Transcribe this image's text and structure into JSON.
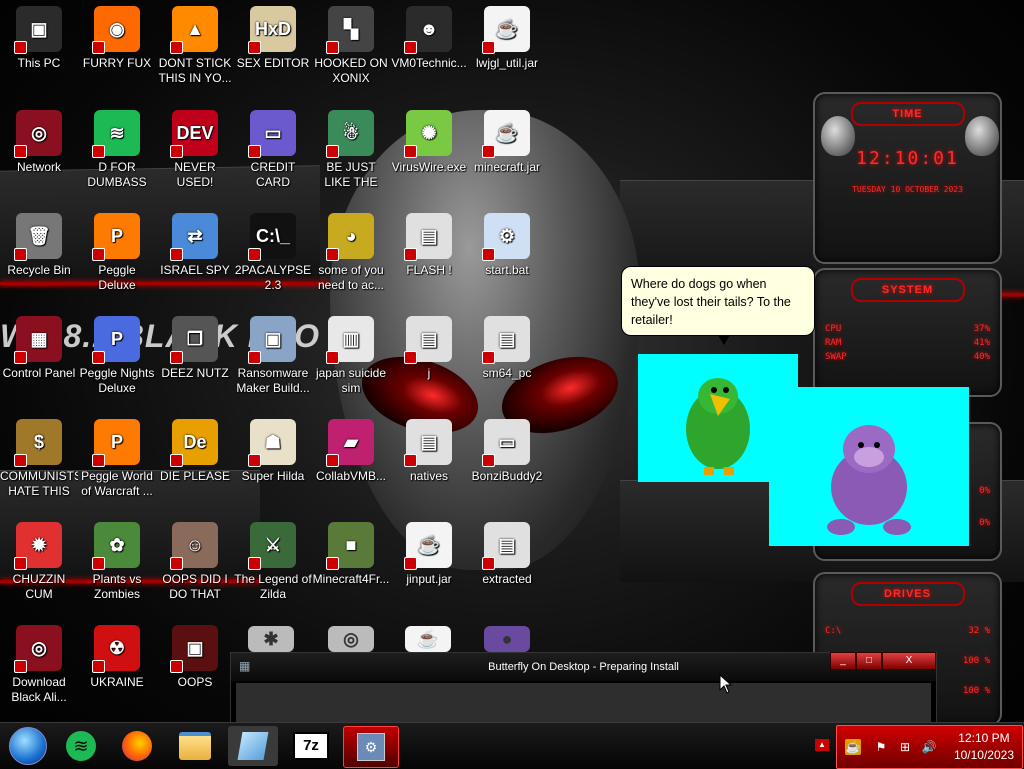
{
  "desktop": {
    "wallpaper_watermark": "WS 8.1 BLACK PRO",
    "icons": [
      {
        "label": "This PC",
        "icon": "computer-icon",
        "color": "#2b2b2b",
        "glyph": "▣"
      },
      {
        "label": "FURRY FUX",
        "icon": "firefox-icon",
        "color": "#ff6a00",
        "glyph": "◉"
      },
      {
        "label": "DONT STICK THIS IN YO...",
        "icon": "vlc-cone-icon",
        "color": "#ff8a00",
        "glyph": "▲"
      },
      {
        "label": "SEX EDITOR",
        "icon": "hex-editor-icon",
        "color": "#d9c9a0",
        "glyph": "HxD"
      },
      {
        "label": "HOOKED ON XONIX",
        "icon": "xonix-game-icon",
        "color": "#444",
        "glyph": "▚"
      },
      {
        "label": "VM0Technic...",
        "icon": "doctor-person-icon",
        "color": "#2b2b2b",
        "glyph": "☻"
      },
      {
        "label": "lwjgl_util.jar",
        "icon": "java-jar-icon",
        "color": "#f4f4f4",
        "glyph": "☕"
      },
      {
        "label": "Network",
        "icon": "network-icon",
        "color": "#8a1020",
        "glyph": "◎"
      },
      {
        "label": "D FOR DUMBASS",
        "icon": "spotify-icon",
        "color": "#1db954",
        "glyph": "≋"
      },
      {
        "label": "NEVER USED!",
        "icon": "dev-cpp-icon",
        "color": "#c0001a",
        "glyph": "DEV"
      },
      {
        "label": "CREDIT CARD CHECKER",
        "icon": "credit-card-icon",
        "color": "#6a5acd",
        "glyph": "▭"
      },
      {
        "label": "BE JUST LIKE THE DUDE!",
        "icon": "elf-game-icon",
        "color": "#3a8a5a",
        "glyph": "☃"
      },
      {
        "label": "VirusWire.exe",
        "icon": "lime-icon",
        "color": "#7ac943",
        "glyph": "✺"
      },
      {
        "label": "minecraft.jar",
        "icon": "java-jar-icon",
        "color": "#f4f4f4",
        "glyph": "☕"
      },
      {
        "label": "Recycle Bin",
        "icon": "recycle-bin-icon",
        "color": "#777",
        "glyph": "🗑"
      },
      {
        "label": "Peggle Deluxe",
        "icon": "peggle-icon",
        "color": "#ff7a00",
        "glyph": "P"
      },
      {
        "label": "ISRAEL SPY",
        "icon": "network-share-icon",
        "color": "#4a8ad8",
        "glyph": "⇄"
      },
      {
        "label": "2PACALYPSE 2.3",
        "icon": "terminal-icon",
        "color": "#111",
        "glyph": "C:\\_"
      },
      {
        "label": "some of you need to ac...",
        "icon": "bear-cartoon-icon",
        "color": "#c8aa20",
        "glyph": "◕"
      },
      {
        "label": "FLASH !",
        "icon": "file-icon",
        "color": "#e0e0e0",
        "glyph": "▤"
      },
      {
        "label": "start.bat",
        "icon": "batch-gear-icon",
        "color": "#cfe0f4",
        "glyph": "⚙"
      },
      {
        "label": "Control Panel",
        "icon": "control-panel-icon",
        "color": "#8a1020",
        "glyph": "▦"
      },
      {
        "label": "Peggle Nights Deluxe",
        "icon": "peggle-icon",
        "color": "#4a6adf",
        "glyph": "P"
      },
      {
        "label": "DEEZ NUTZ",
        "icon": "stacked-windows-icon",
        "color": "#555",
        "glyph": "❐"
      },
      {
        "label": "Ransomware Maker Build...",
        "icon": "window-builder-icon",
        "color": "#8aa4c8",
        "glyph": "▣"
      },
      {
        "label": "japan suicide sim",
        "icon": "game-file-icon",
        "color": "#e8e8e8",
        "glyph": "▥"
      },
      {
        "label": "j",
        "icon": "file-icon",
        "color": "#e0e0e0",
        "glyph": "▤"
      },
      {
        "label": "sm64_pc",
        "icon": "file-icon",
        "color": "#e0e0e0",
        "glyph": "▤"
      },
      {
        "label": "COMMUNISTS HATE THIS G...",
        "icon": "money-bag-icon",
        "color": "#a0782a",
        "glyph": "$"
      },
      {
        "label": "Peggle World of Warcraft ...",
        "icon": "peggle-icon",
        "color": "#ff7a00",
        "glyph": "P"
      },
      {
        "label": "DIE PLEASE",
        "icon": "de-icon",
        "color": "#e8a000",
        "glyph": "De"
      },
      {
        "label": "Super Hilda",
        "icon": "pixel-character-icon",
        "color": "#e8e0c8",
        "glyph": "☗"
      },
      {
        "label": "CollabVMB...",
        "icon": "collabvm-icon",
        "color": "#c02070",
        "glyph": "▰"
      },
      {
        "label": "natives",
        "icon": "file-icon",
        "color": "#e0e0e0",
        "glyph": "▤"
      },
      {
        "label": "BonziBuddy2",
        "icon": "window-file-icon",
        "color": "#e0e0e0",
        "glyph": "▭"
      },
      {
        "label": "CHUZZIN CUM",
        "icon": "chuzzle-icon",
        "color": "#e03030",
        "glyph": "✹"
      },
      {
        "label": "Plants vs Zombies",
        "icon": "flower-icon",
        "color": "#4a8a3a",
        "glyph": "✿"
      },
      {
        "label": "OOPS DID I DO THAT",
        "icon": "portrait-icon",
        "color": "#8a6a5a",
        "glyph": "☺"
      },
      {
        "label": "The Legend of Zilda",
        "icon": "zelda-icon",
        "color": "#3a6a3a",
        "glyph": "⚔"
      },
      {
        "label": "Minecraft4Fr...",
        "icon": "minecraft-block-icon",
        "color": "#5a7a3a",
        "glyph": "■"
      },
      {
        "label": "jinput.jar",
        "icon": "java-jar-icon",
        "color": "#f4f4f4",
        "glyph": "☕"
      },
      {
        "label": "extracted",
        "icon": "file-icon",
        "color": "#e0e0e0",
        "glyph": "▤"
      },
      {
        "label": "Download Black Ali...",
        "icon": "alien-badge-icon",
        "color": "#8a1020",
        "glyph": "◎"
      },
      {
        "label": "UKRAINE",
        "icon": "radiation-icon",
        "color": "#d01010",
        "glyph": "☢"
      },
      {
        "label": "OOPS",
        "icon": "monitor-red-icon",
        "color": "#5a1010",
        "glyph": "▣"
      }
    ],
    "partial_icons": [
      {
        "icon": "tool-icon",
        "glyph": "✱"
      },
      {
        "icon": "ring-icon",
        "glyph": "◎"
      },
      {
        "icon": "java-jar-icon",
        "glyph": "☕"
      },
      {
        "icon": "bonzi-icon",
        "glyph": "●"
      }
    ]
  },
  "gadget": {
    "time_header": "TIME",
    "time": "12:10:01",
    "date": "TUESDAY 10 OCTOBER 2023",
    "system_header": "SYSTEM",
    "stats": [
      {
        "label": "CPU",
        "value": "37%"
      },
      {
        "label": "RAM",
        "value": "41%"
      },
      {
        "label": "SWAP",
        "value": "40%"
      }
    ],
    "mid_values": [
      "0%",
      "0%"
    ],
    "drives_header": "DRIVES",
    "drives": [
      {
        "label": "C:\\",
        "value": "32 %"
      },
      {
        "label": "",
        "value": "100 %"
      },
      {
        "label": "",
        "value": "100 %"
      }
    ],
    "accent": "#ff2a2a"
  },
  "bonzi": {
    "speech": "Where do dogs go when they've lost their tails? To the retailer!"
  },
  "installer": {
    "title": "Butterfly On Desktop - Preparing Install",
    "minimize": "_",
    "maximize": "□",
    "close": "X"
  },
  "taskbar": {
    "apps": [
      {
        "name": "start-orb",
        "glyph": "●"
      },
      {
        "name": "spotify-taskbar",
        "glyph": "≋"
      },
      {
        "name": "firefox-taskbar",
        "glyph": "◉"
      },
      {
        "name": "file-explorer-taskbar",
        "glyph": "▭"
      },
      {
        "name": "notepad-taskbar",
        "glyph": "▱"
      },
      {
        "name": "7zip-taskbar",
        "glyph": "7z"
      },
      {
        "name": "installer-taskbar",
        "glyph": "⚙"
      }
    ],
    "clock_time": "12:10 PM",
    "clock_date": "10/10/2023",
    "show_hidden": "▲"
  }
}
